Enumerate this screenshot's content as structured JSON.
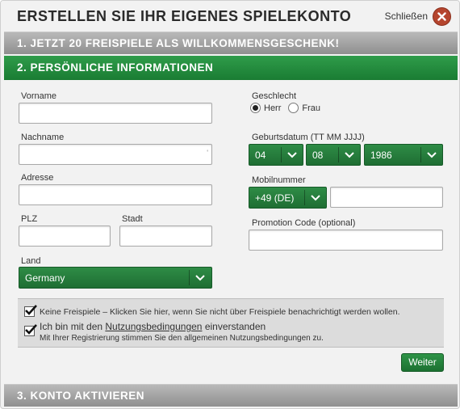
{
  "header": {
    "title": "ERSTELLEN SIE IHR EIGENES SPIELEKONTO",
    "close_label": "Schließen"
  },
  "steps": {
    "step1": "1. JETZT 20 FREISPIELE ALS WILLKOMMENSGESCHENK!",
    "step2": "2. PERSÖNLICHE INFORMATIONEN",
    "step3": "3. KONTO AKTIVIEREN"
  },
  "form": {
    "vorname": {
      "label": "Vorname",
      "value": ""
    },
    "nachname": {
      "label": "Nachname",
      "value": ""
    },
    "adresse": {
      "label": "Adresse",
      "value": ""
    },
    "plz": {
      "label": "PLZ",
      "value": ""
    },
    "stadt": {
      "label": "Stadt",
      "value": ""
    },
    "land": {
      "label": "Land",
      "selected": "Germany"
    },
    "geschlecht": {
      "label": "Geschlecht",
      "options": [
        "Herr",
        "Frau"
      ],
      "selected": "Herr"
    },
    "geburtsdatum": {
      "label": "Geburtsdatum (TT MM JJJJ)",
      "day": "04",
      "month": "08",
      "year": "1986"
    },
    "mobilnummer": {
      "label": "Mobilnummer",
      "prefix": "+49 (DE)",
      "value": ""
    },
    "promotion": {
      "label": "Promotion Code (optional)",
      "value": ""
    }
  },
  "consent": {
    "no_freespins": "Keine Freispiele – Klicken Sie hier, wenn Sie nicht über Freispiele benachrichtigt werden wollen.",
    "terms_prefix": "Ich bin mit den ",
    "terms_link": "Nutzungsbedingungen",
    "terms_suffix": " einverstanden",
    "terms_note": "Mit Ihrer Registrierung stimmen Sie den allgemeinen Nutzungsbedingungen zu."
  },
  "actions": {
    "next_label": "Weiter"
  },
  "colors": {
    "accent_green": "#1f7a36",
    "close_red": "#b5452e",
    "step_grey": "#9e9e9e"
  }
}
